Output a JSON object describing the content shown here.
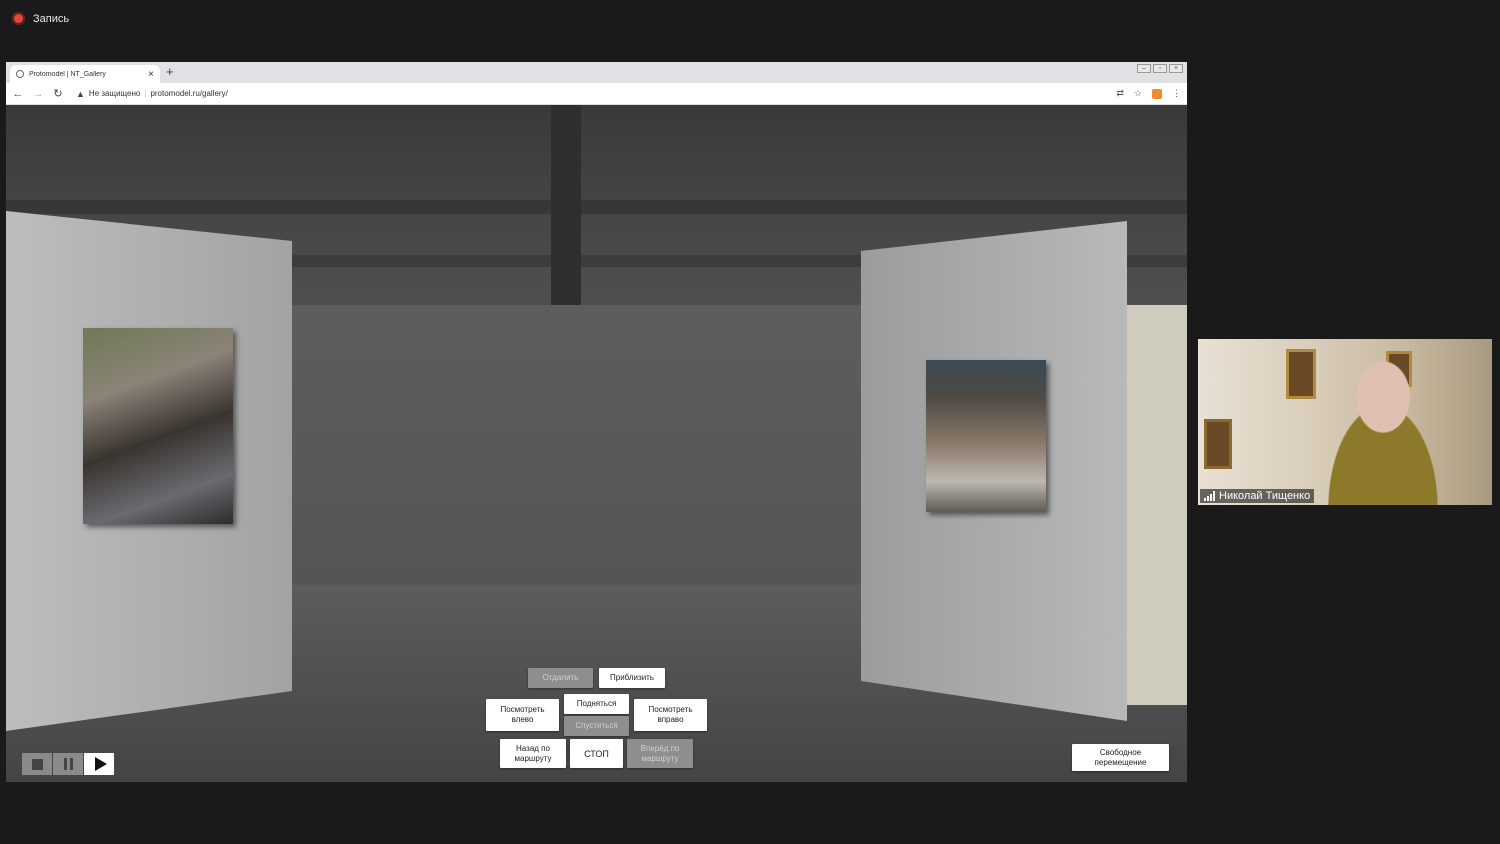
{
  "recording": {
    "label": "Запись"
  },
  "browser": {
    "tab_title": "Protomodel | NT_Gallery",
    "new_tab": "+",
    "security_label": "Не защищено",
    "url": "protomodel.ru/gallery/"
  },
  "controls": {
    "zoom_out": "Отдалить",
    "zoom_in": "Приблизить",
    "look_left": "Посмотреть влево",
    "up": "Подняться",
    "down": "Спуститься",
    "look_right": "Посмотреть вправо",
    "back": "Назад по маршруту",
    "stop": "СТОП",
    "forward": "Вперёд по маршруту",
    "free_move": "Свободное перемещение"
  },
  "video": {
    "participant_name": "Николай Тищенко"
  },
  "icons": {
    "back": "arrow-left-icon",
    "forward": "arrow-right-icon",
    "reload": "reload-icon",
    "warning": "warning-icon",
    "translate": "translate-icon",
    "star": "star-icon",
    "menu": "menu-dots-icon"
  }
}
